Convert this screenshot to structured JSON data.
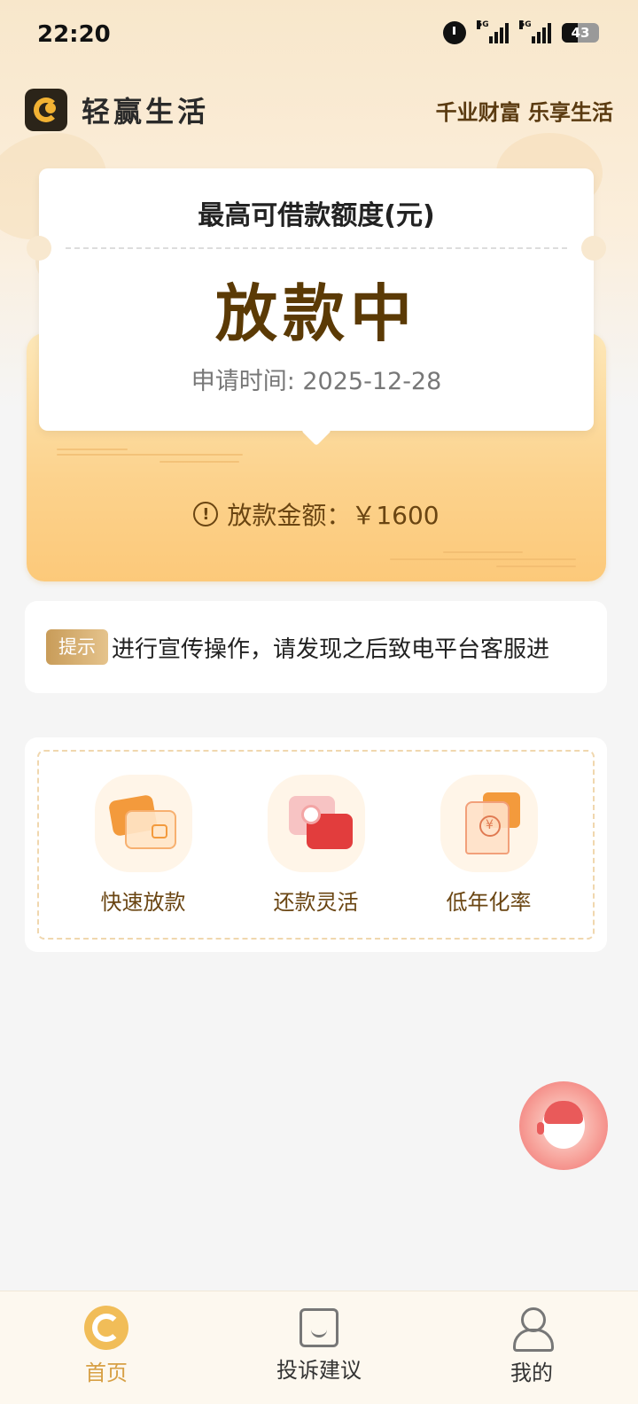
{
  "status_bar": {
    "time": "22:20",
    "signal_1": "5G",
    "signal_2": "5G",
    "battery": "43"
  },
  "header": {
    "app_name": "轻赢生活",
    "slogan": "千业财富 乐享生活"
  },
  "limit_card": {
    "title": "最高可借款额度(元)",
    "status": "放款中",
    "apply_time_label": "申请时间: 2025-12-28",
    "amount_label": "放款金额：￥1600"
  },
  "notice": {
    "tag": "提示",
    "text": "进行宣传操作，请发现之后致电平台客服进"
  },
  "features": [
    {
      "label": "快速放款",
      "icon": "wallet-icon"
    },
    {
      "label": "还款灵活",
      "icon": "chat-coin-icon"
    },
    {
      "label": "低年化率",
      "icon": "money-bag-icon"
    }
  ],
  "service": {
    "icon": "customer-service-icon"
  },
  "tabs": [
    {
      "label": "首页",
      "icon": "home-icon",
      "active": true
    },
    {
      "label": "投诉建议",
      "icon": "complaint-icon",
      "active": false
    },
    {
      "label": "我的",
      "icon": "profile-icon",
      "active": false
    }
  ],
  "colors": {
    "accent": "#d7a045",
    "status_brown": "#5b3a05",
    "envelope": "#fcd28c",
    "service_red": "#f06b6b"
  }
}
